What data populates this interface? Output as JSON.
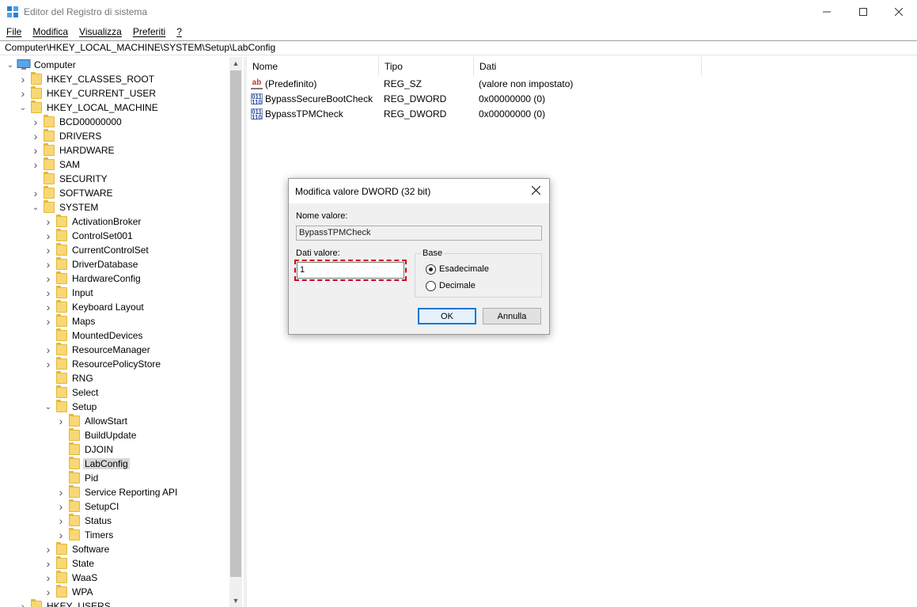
{
  "window": {
    "title": "Editor del Registro di sistema",
    "minimize": "—",
    "maximize": "☐",
    "close": "✕"
  },
  "menu": [
    "File",
    "Modifica",
    "Visualizza",
    "Preferiti",
    "?"
  ],
  "address": "Computer\\HKEY_LOCAL_MACHINE\\SYSTEM\\Setup\\LabConfig",
  "tree": {
    "root": "Computer",
    "nodes": [
      {
        "label": "HKEY_CLASSES_ROOT",
        "level": 1,
        "expander": "collapsed"
      },
      {
        "label": "HKEY_CURRENT_USER",
        "level": 1,
        "expander": "collapsed"
      },
      {
        "label": "HKEY_LOCAL_MACHINE",
        "level": 1,
        "expander": "expanded"
      },
      {
        "label": "BCD00000000",
        "level": 2,
        "expander": "collapsed"
      },
      {
        "label": "DRIVERS",
        "level": 2,
        "expander": "collapsed"
      },
      {
        "label": "HARDWARE",
        "level": 2,
        "expander": "collapsed"
      },
      {
        "label": "SAM",
        "level": 2,
        "expander": "collapsed"
      },
      {
        "label": "SECURITY",
        "level": 2,
        "expander": "none"
      },
      {
        "label": "SOFTWARE",
        "level": 2,
        "expander": "collapsed"
      },
      {
        "label": "SYSTEM",
        "level": 2,
        "expander": "expanded"
      },
      {
        "label": "ActivationBroker",
        "level": 3,
        "expander": "collapsed"
      },
      {
        "label": "ControlSet001",
        "level": 3,
        "expander": "collapsed"
      },
      {
        "label": "CurrentControlSet",
        "level": 3,
        "expander": "collapsed"
      },
      {
        "label": "DriverDatabase",
        "level": 3,
        "expander": "collapsed"
      },
      {
        "label": "HardwareConfig",
        "level": 3,
        "expander": "collapsed"
      },
      {
        "label": "Input",
        "level": 3,
        "expander": "collapsed"
      },
      {
        "label": "Keyboard Layout",
        "level": 3,
        "expander": "collapsed"
      },
      {
        "label": "Maps",
        "level": 3,
        "expander": "collapsed"
      },
      {
        "label": "MountedDevices",
        "level": 3,
        "expander": "none"
      },
      {
        "label": "ResourceManager",
        "level": 3,
        "expander": "collapsed"
      },
      {
        "label": "ResourcePolicyStore",
        "level": 3,
        "expander": "collapsed"
      },
      {
        "label": "RNG",
        "level": 3,
        "expander": "none"
      },
      {
        "label": "Select",
        "level": 3,
        "expander": "none"
      },
      {
        "label": "Setup",
        "level": 3,
        "expander": "expanded"
      },
      {
        "label": "AllowStart",
        "level": 4,
        "expander": "collapsed"
      },
      {
        "label": "BuildUpdate",
        "level": 4,
        "expander": "none"
      },
      {
        "label": "DJOIN",
        "level": 4,
        "expander": "none"
      },
      {
        "label": "LabConfig",
        "level": 4,
        "expander": "none",
        "selected": true
      },
      {
        "label": "Pid",
        "level": 4,
        "expander": "none"
      },
      {
        "label": "Service Reporting API",
        "level": 4,
        "expander": "collapsed"
      },
      {
        "label": "SetupCI",
        "level": 4,
        "expander": "collapsed"
      },
      {
        "label": "Status",
        "level": 4,
        "expander": "collapsed"
      },
      {
        "label": "Timers",
        "level": 4,
        "expander": "collapsed"
      },
      {
        "label": "Software",
        "level": 3,
        "expander": "collapsed"
      },
      {
        "label": "State",
        "level": 3,
        "expander": "collapsed"
      },
      {
        "label": "WaaS",
        "level": 3,
        "expander": "collapsed"
      },
      {
        "label": "WPA",
        "level": 3,
        "expander": "collapsed"
      },
      {
        "label": "HKEY_USERS",
        "level": 1,
        "expander": "collapsed"
      }
    ]
  },
  "list": {
    "columns": [
      "Nome",
      "Tipo",
      "Dati"
    ],
    "rows": [
      {
        "icon": "string-value-icon",
        "name": "(Predefinito)",
        "type": "REG_SZ",
        "data": "(valore non impostato)"
      },
      {
        "icon": "binary-value-icon",
        "name": "BypassSecureBootCheck",
        "type": "REG_DWORD",
        "data": "0x00000000 (0)"
      },
      {
        "icon": "binary-value-icon",
        "name": "BypassTPMCheck",
        "type": "REG_DWORD",
        "data": "0x00000000 (0)"
      }
    ]
  },
  "dialog": {
    "title": "Modifica valore DWORD (32 bit)",
    "name_label": "Nome valore:",
    "name_value": "BypassTPMCheck",
    "data_label": "Dati valore:",
    "data_value": "1",
    "base_label": "Base",
    "radio_hex": "Esadecimale",
    "radio_dec": "Decimale",
    "selected_base": "Esadecimale",
    "ok": "OK",
    "cancel": "Annulla"
  },
  "colors": {
    "highlight_outline": "#d0021b",
    "folder": "#f8d775",
    "selection": "#d9d9d9"
  }
}
